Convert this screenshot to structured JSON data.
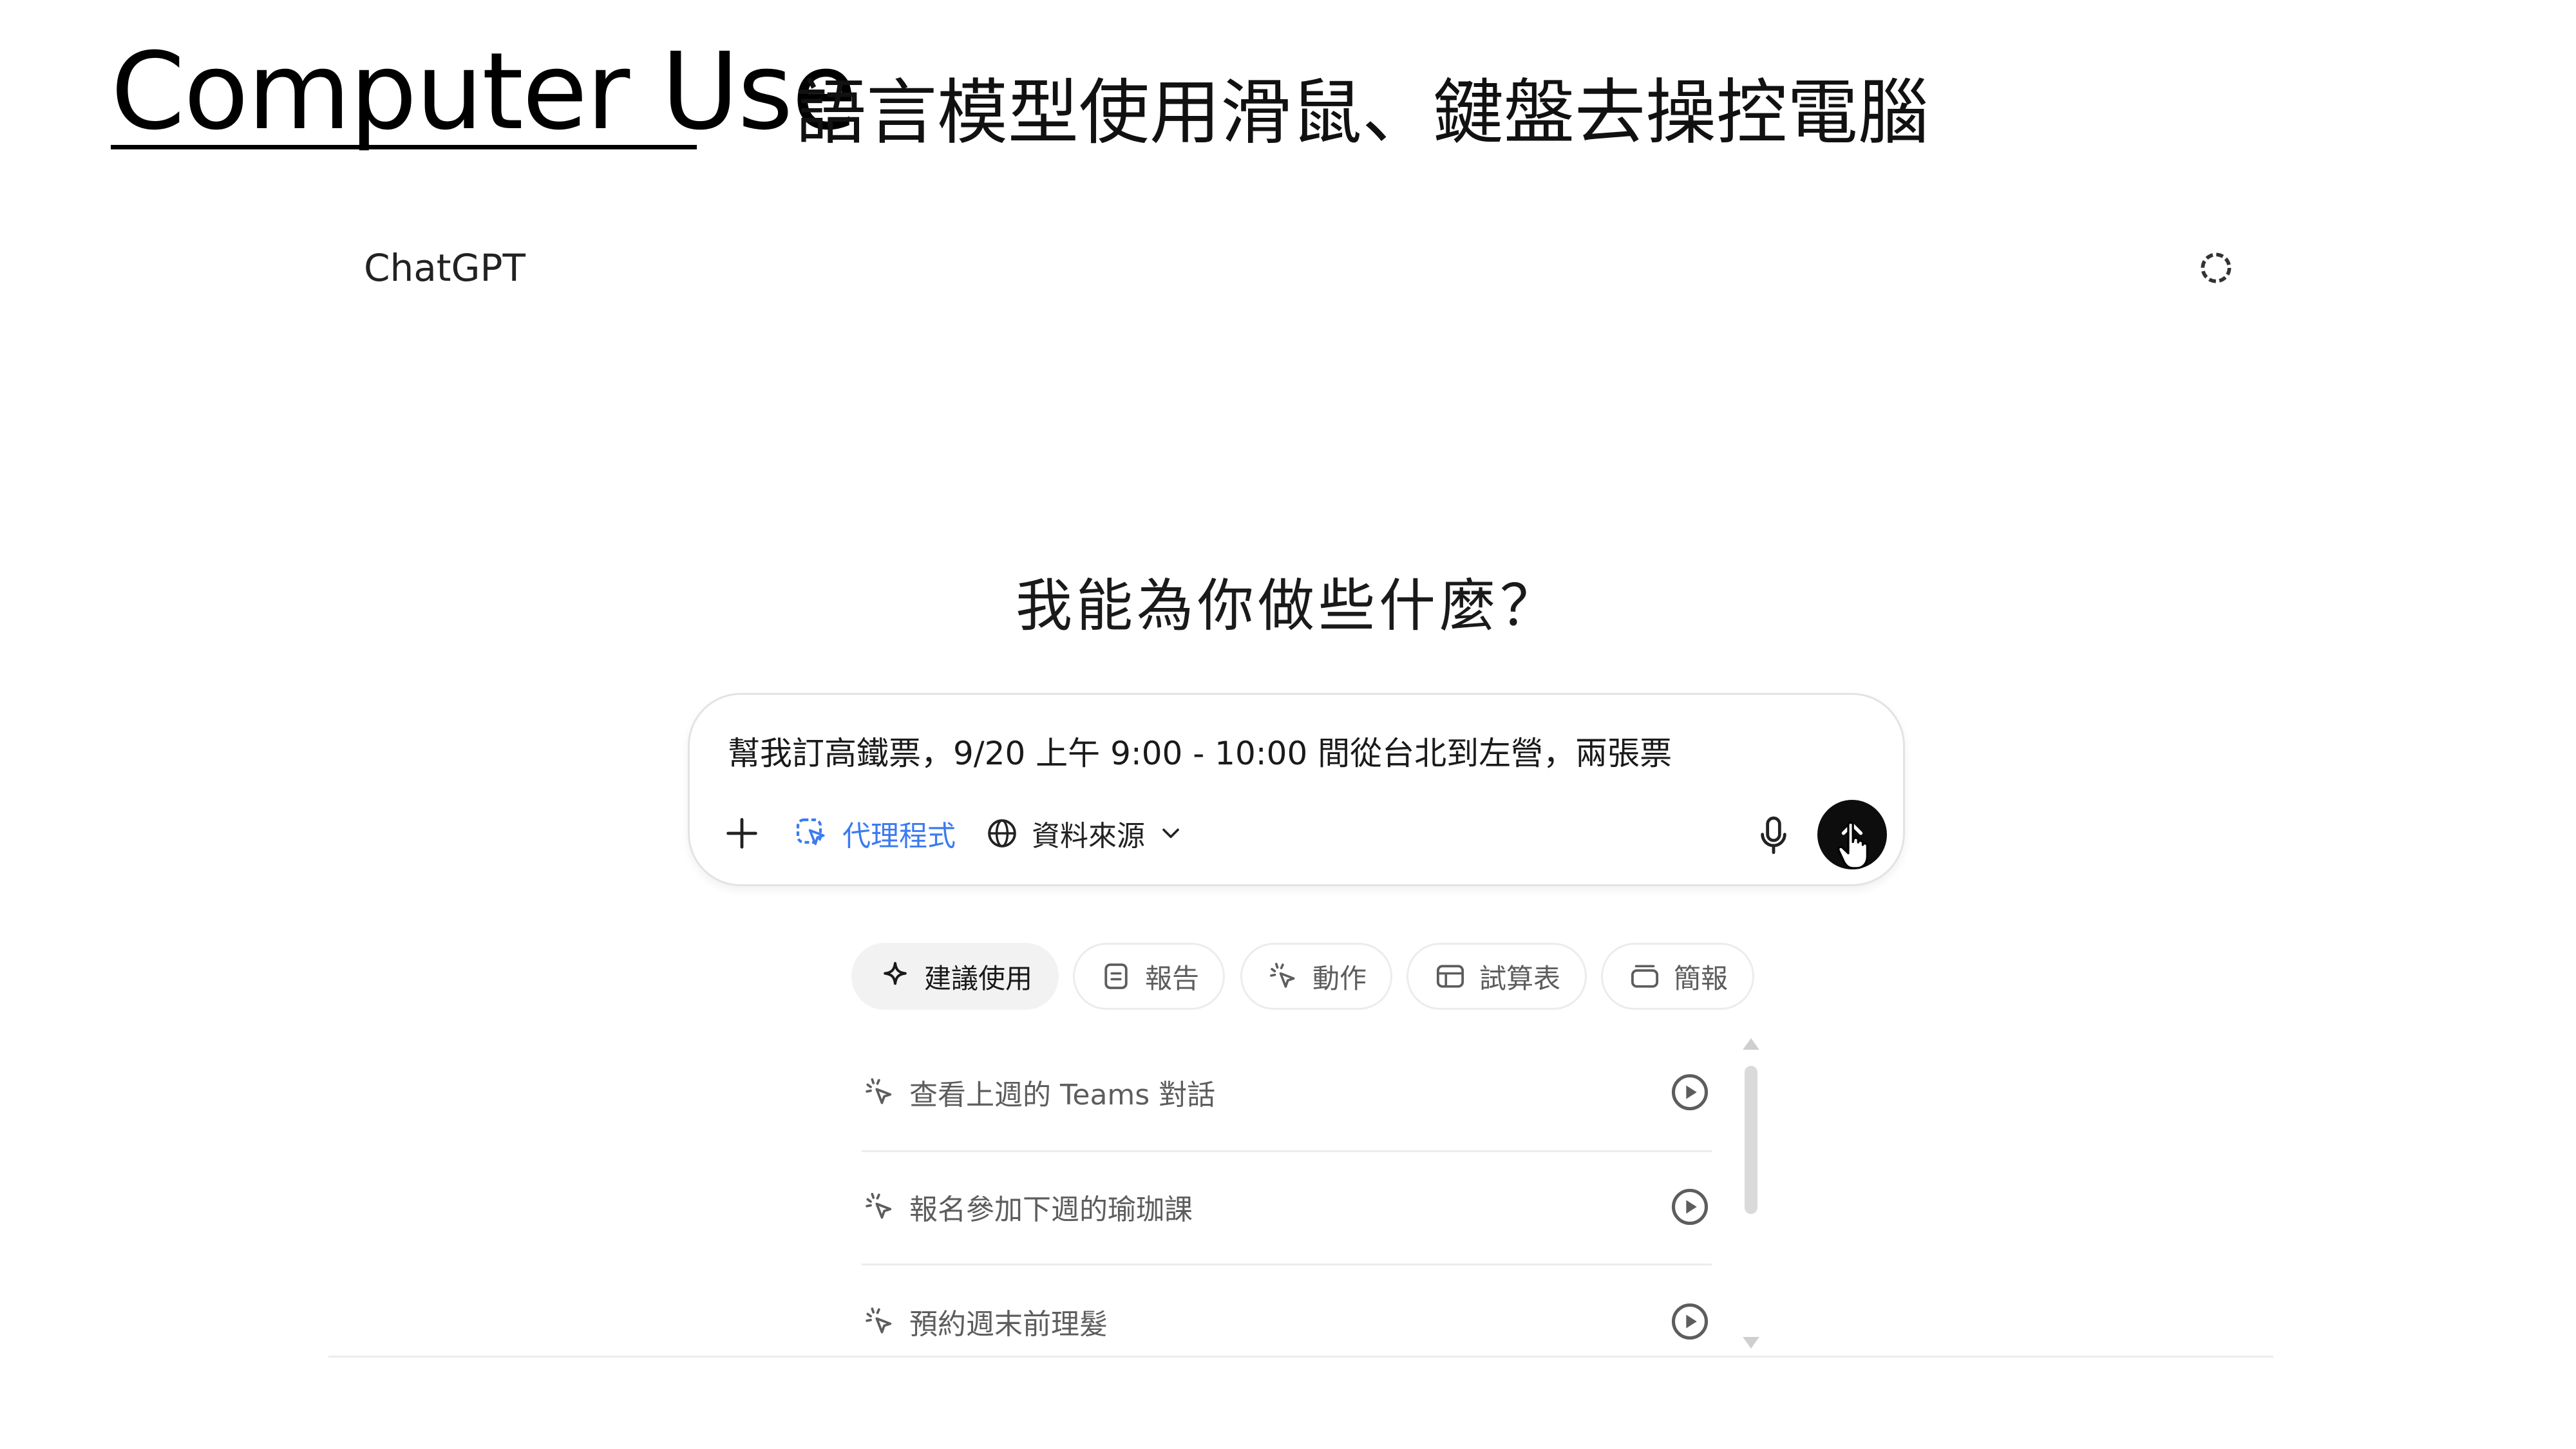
{
  "slide": {
    "title": "Computer Use",
    "subtitle": "語言模型使用滑鼠、鍵盤去操控電腦"
  },
  "app": {
    "name": "ChatGPT",
    "temp_chat_icon": "dashed-circle-icon"
  },
  "main": {
    "headline": "我能為你做些什麼？"
  },
  "composer": {
    "input_value": "幫我訂高鐵票，9/20 上午 9:00 - 10:00 間從台北到左營，兩張票",
    "add_icon": "plus-icon",
    "agent_tool_label": "代理程式",
    "agent_tool_icon": "agent-cursor-icon",
    "sources_label": "資料來源",
    "sources_icon": "globe-icon",
    "sources_chevron": "chevron-down-icon",
    "mic_icon": "microphone-icon",
    "send_icon": "arrow-up-icon"
  },
  "categories": [
    {
      "label": "建議使用",
      "icon": "sparkle-icon",
      "active": true
    },
    {
      "label": "報告",
      "icon": "document-icon",
      "active": false
    },
    {
      "label": "動作",
      "icon": "click-icon",
      "active": false
    },
    {
      "label": "試算表",
      "icon": "table-icon",
      "active": false
    },
    {
      "label": "簡報",
      "icon": "slides-icon",
      "active": false
    }
  ],
  "suggestions": [
    {
      "label": "查看上週的 Teams 對話",
      "icon": "click-icon",
      "action_icon": "play-icon"
    },
    {
      "label": "報名參加下週的瑜珈課",
      "icon": "click-icon",
      "action_icon": "play-icon"
    },
    {
      "label": "預約週末前理髮",
      "icon": "click-icon",
      "action_icon": "play-icon"
    }
  ],
  "colors": {
    "accent_blue": "#3b7bf0",
    "send_button": "#0d0d0d",
    "muted_text": "#5d5d5d"
  }
}
